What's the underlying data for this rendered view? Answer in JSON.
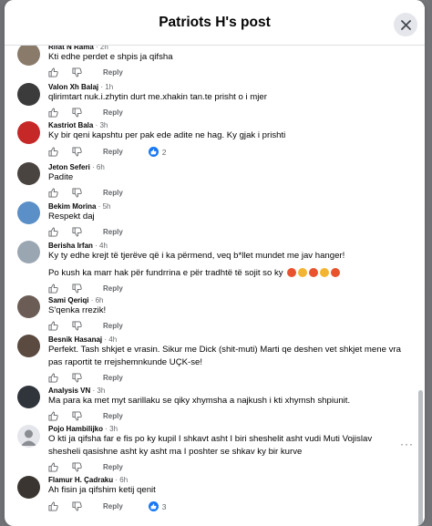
{
  "header": {
    "title": "Patriots H's post"
  },
  "actions": {
    "reply_label": "Reply"
  },
  "comments": [
    {
      "name": "Rifat N Rama",
      "time": "2h",
      "lines": [
        "Kti edhe perdet e shpis ja qifsha"
      ]
    },
    {
      "name": "Valon Xh Balaj",
      "time": "1h",
      "lines": [
        "qlirimtart nuk.i.zhytin durt me.xhakin tan.te prisht o i mjer"
      ]
    },
    {
      "name": "Kastriot Bala",
      "time": "3h",
      "lines": [
        "Ky bir qeni kapshtu per pak ede adite ne hag. Ky gjak i prishti"
      ],
      "reactions": "2"
    },
    {
      "name": "Jeton Seferi",
      "time": "6h",
      "lines": [
        "Padite"
      ]
    },
    {
      "name": "Bekim Morina",
      "time": "5h",
      "lines": [
        "Respekt daj"
      ]
    },
    {
      "name": "Berisha Irfan",
      "time": "4h",
      "lines": [
        "Ky ty edhe krejt të tjerëve që i ka përmend, veq b*llet mundet me jav hanger!",
        "",
        "Po kush ka marr hak për fundrrina e për tradhtë të sojit so ky"
      ]
    },
    {
      "name": "Sami Qeriqi",
      "time": "6h",
      "lines": [
        "S'qenka rrezik!"
      ]
    },
    {
      "name": "Besnik Hasanaj",
      "time": "4h",
      "lines": [
        "Perfekt. Tash shkjet e vrasin. Sikur me Dick (shit-muti) Marti qe deshen vet shkjet mene vra",
        "pas raportit te rrejshemnkunde UÇK-se!"
      ]
    },
    {
      "name": "Analysis VN",
      "time": "3h",
      "lines": [
        "Ma para ka met myt sarillaku se qiky xhymsha a najkush i kti xhymsh shpiunit."
      ]
    },
    {
      "name": "Pojo Hambilijko",
      "time": "3h",
      "lines": [
        "O kti ja qifsha far e fis po ky kupil I shkavt asht I biri sheshelit asht vudi Muti Vojislav",
        "shesheli qasishne asht ky asht ma I poshter se shkav ky bir kurve"
      ]
    },
    {
      "name": "Flamur H. Çadraku",
      "time": "6h",
      "lines": [
        "Ah fisin ja qifshim ketij qenit"
      ],
      "reactions": "3"
    }
  ]
}
